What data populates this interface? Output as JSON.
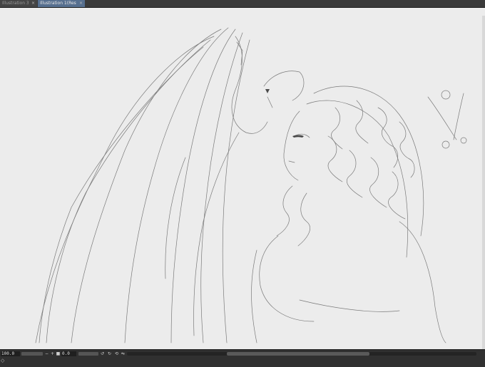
{
  "tabs": [
    {
      "label": "Illustration 3(Bro",
      "close": "×"
    },
    {
      "label": "Illustration 1(Restore)*",
      "close": "×"
    }
  ],
  "statusbar": {
    "zoom": "100.0",
    "angle": "0.0",
    "bottom_glyph": "◇"
  },
  "colors": {
    "canvas": "#ececec",
    "active_tab": "#566f8f",
    "chrome": "#303030"
  },
  "icons": [
    "close-icon",
    "zoom-out-icon",
    "zoom-in-icon",
    "fit-icon",
    "rotate-left-icon",
    "rotate-right-icon",
    "reset-rotation-icon",
    "flip-icon"
  ]
}
